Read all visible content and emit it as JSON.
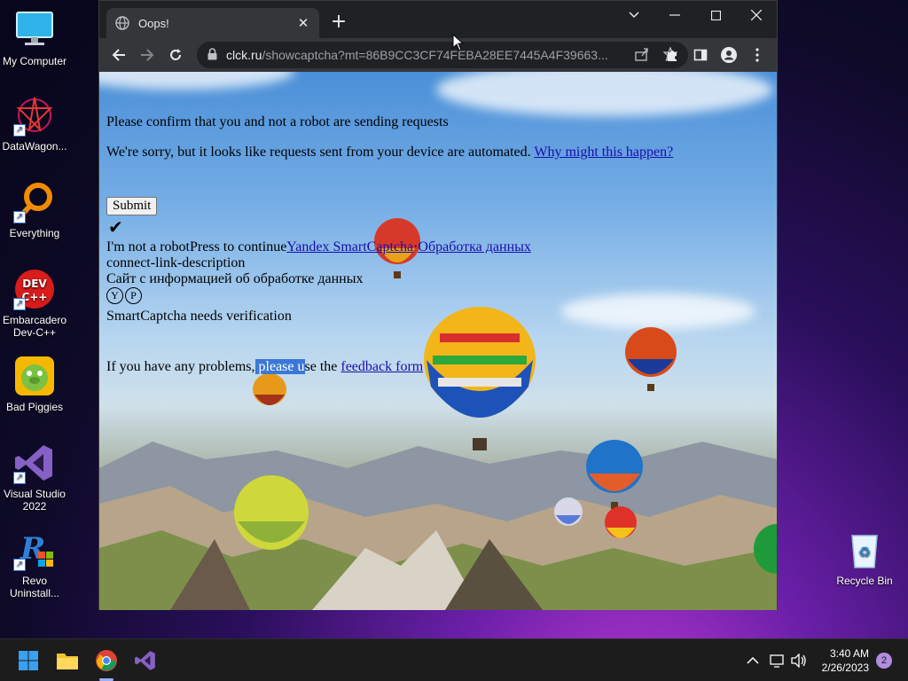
{
  "desktop": {
    "icons": [
      {
        "label": "My Computer",
        "icon": "monitor-icon"
      },
      {
        "label": "DataWagon...",
        "icon": "datawagon-icon"
      },
      {
        "label": "Everything",
        "icon": "everything-search-icon"
      },
      {
        "label": "Embarcadero\nDev-C++",
        "icon": "devcpp-icon",
        "line1": "Embarcadero",
        "line2": "Dev-C++"
      },
      {
        "label": "Bad Piggies",
        "icon": "bad-piggies-icon"
      },
      {
        "label": "Visual Studio 2022",
        "icon": "visual-studio-icon",
        "line1": "Visual Studio",
        "line2": "2022"
      },
      {
        "label": "Revo Uninstall...",
        "icon": "revo-uninstaller-icon",
        "line1": "Revo",
        "line2": "Uninstall..."
      }
    ],
    "recycle_bin": {
      "label": "Recycle Bin",
      "icon": "recycle-bin-icon"
    }
  },
  "browser": {
    "tab": {
      "title": "Oops!",
      "close_glyph": "✕"
    },
    "new_tab_glyph": "+",
    "window_controls": {
      "dropdown": "⌄",
      "minimize": "—",
      "maximize": "☐",
      "close": "✕"
    },
    "address": {
      "host": "clck.ru",
      "path": "/showcaptcha?mt=86B9CC3CF74FEBA28EE7445A4F39663..."
    }
  },
  "page": {
    "heading": "Please confirm that you and not a robot are sending requests",
    "sorry_text": "We're sorry, but it looks like requests sent from your device are automated.",
    "why_link": "Why might this happen?",
    "submit_label": "Submit",
    "check_glyph": "✔",
    "robot_text": "I'm not a robotPress to continue",
    "yandex_link": "Yandex SmartCaptcha",
    "separator": "·",
    "data_link": "Обработка данных",
    "connect_desc": "connect-link-description",
    "info_text": "Сайт с информацией об обработке данных",
    "icon_y": "Y",
    "icon_p": "P",
    "verify_text": "SmartCaptcha needs verification",
    "problems_prefix": "If you have any problems,",
    "problems_selected": " please u",
    "problems_mid": "se the",
    "feedback_link": "feedback form"
  },
  "taskbar": {
    "time": "3:40 AM",
    "date": "2/26/2023",
    "notification_count": "2"
  },
  "colors": {
    "link": "#1a0dab",
    "selection": "#3b78d6",
    "browser_dark": "#202124",
    "toolbar": "#35363a"
  }
}
